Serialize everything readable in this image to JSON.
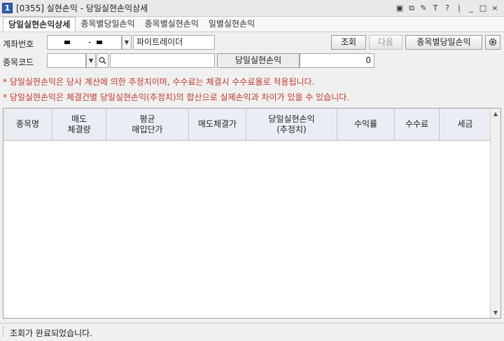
{
  "window": {
    "badge": "1",
    "title": "[0355]  실현손익 - 당일실현손익상세",
    "controls": [
      "▣",
      "⧉",
      "✎",
      "T",
      "?",
      "|",
      "_",
      "□",
      "×"
    ]
  },
  "tabs": [
    {
      "label": "당일실현손익상세",
      "active": true
    },
    {
      "label": "종목별당일손익",
      "active": false
    },
    {
      "label": "종목별실현손익",
      "active": false
    },
    {
      "label": "일별실현손익",
      "active": false
    }
  ],
  "form": {
    "account_label": "계좌번호",
    "account_value": "-",
    "account_name": "파이트레이더",
    "search_button": "조회",
    "next_button": "다음",
    "stock_pnl_button": "종목별당일손익",
    "stock_code_label": "종목코드",
    "stock_code_value": "",
    "stock_name_value": "",
    "realized_label": "당일실현손익",
    "realized_value": "0"
  },
  "notices": [
    "* 당일실현손익은 당사 계산에 의한 추정치이며, 수수료는 체결시 수수료율로 적용됩니다.",
    "* 당일실현손익은 체결건별 당일실현손익(추정치)의 합산으로 실제손익과 차이가 있을 수 있습니다."
  ],
  "table": {
    "headers": [
      "종목명",
      "매도\n체결량",
      "평균\n매입단가",
      "매도체결가",
      "당일실현손익\n(추정치)",
      "수익률",
      "수수료",
      "세금"
    ],
    "rows": []
  },
  "status": {
    "message": "조회가 완료되었습니다."
  },
  "colors": {
    "notice": "#c0392b",
    "header_bg": "#eaeef4",
    "badge_bg": "#2f5fb0"
  }
}
